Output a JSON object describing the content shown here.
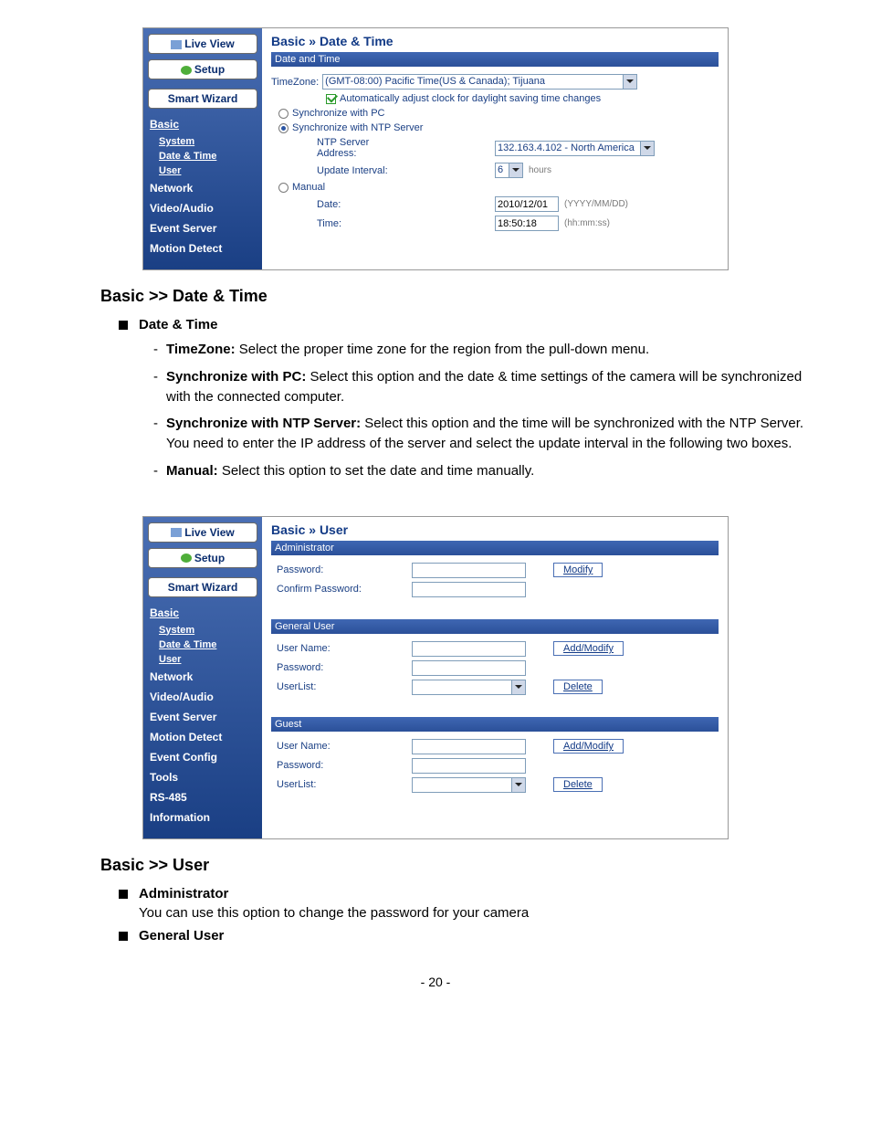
{
  "nav": {
    "live_view": "Live View",
    "setup": "Setup",
    "smart_wizard": "Smart Wizard",
    "basic": "Basic",
    "system": "System",
    "date_time": "Date & Time",
    "user": "User",
    "network": "Network",
    "video_audio": "Video/Audio",
    "event_server": "Event Server",
    "motion_detect": "Motion Detect",
    "event_config": "Event Config",
    "tools": "Tools",
    "rs485": "RS-485",
    "information": "Information"
  },
  "shot1": {
    "crumb_a": "Basic",
    "crumb_sep": " » ",
    "crumb_b": "Date & Time",
    "section": "Date and Time",
    "tz_label": "TimeZone:",
    "tz_value": "(GMT-08:00) Pacific Time(US & Canada); Tijuana",
    "dst": "Automatically adjust clock for daylight saving time changes",
    "sync_pc": "Synchronize with PC",
    "sync_ntp": "Synchronize with NTP Server",
    "ntp_addr_label": "NTP Server Address:",
    "ntp_addr_value": "132.163.4.102 - North America",
    "update_label": "Update Interval:",
    "update_value": "6",
    "update_unit": "hours",
    "manual": "Manual",
    "date_label": "Date:",
    "date_value": "2010/12/01",
    "date_hint": "(YYYY/MM/DD)",
    "time_label": "Time:",
    "time_value": "18:50:18",
    "time_hint": "(hh:mm:ss)"
  },
  "doc1": {
    "heading": "Basic >> Date & Time",
    "top": "Date & Time",
    "i1b": "TimeZone:",
    "i1": " Select the proper time zone for the region from the pull-down menu.",
    "i2b": "Synchronize with PC:",
    "i2": " Select this option and the date & time settings of the camera will be synchronized with the connected computer.",
    "i3b": "Synchronize with NTP Server:",
    "i3": " Select this option and the time will be synchronized with the NTP Server. You need to enter the IP address of the server and select the update interval in the following two boxes.",
    "i4b": "Manual:",
    "i4": " Select this option to set the date and time manually."
  },
  "shot2": {
    "crumb_a": "Basic",
    "crumb_sep": " » ",
    "crumb_b": "User",
    "sec_admin": "Administrator",
    "pw": "Password:",
    "cpw": "Confirm Password:",
    "modify": "Modify",
    "sec_general": "General User",
    "uname": "User Name:",
    "ulist": "UserList:",
    "addmod": "Add/Modify",
    "delete": "Delete",
    "sec_guest": "Guest"
  },
  "doc2": {
    "heading": "Basic >> User",
    "i1": "Administrator",
    "i1t": "You can use this option to change the password for your camera",
    "i2": "General User"
  },
  "page": "- 20 -"
}
